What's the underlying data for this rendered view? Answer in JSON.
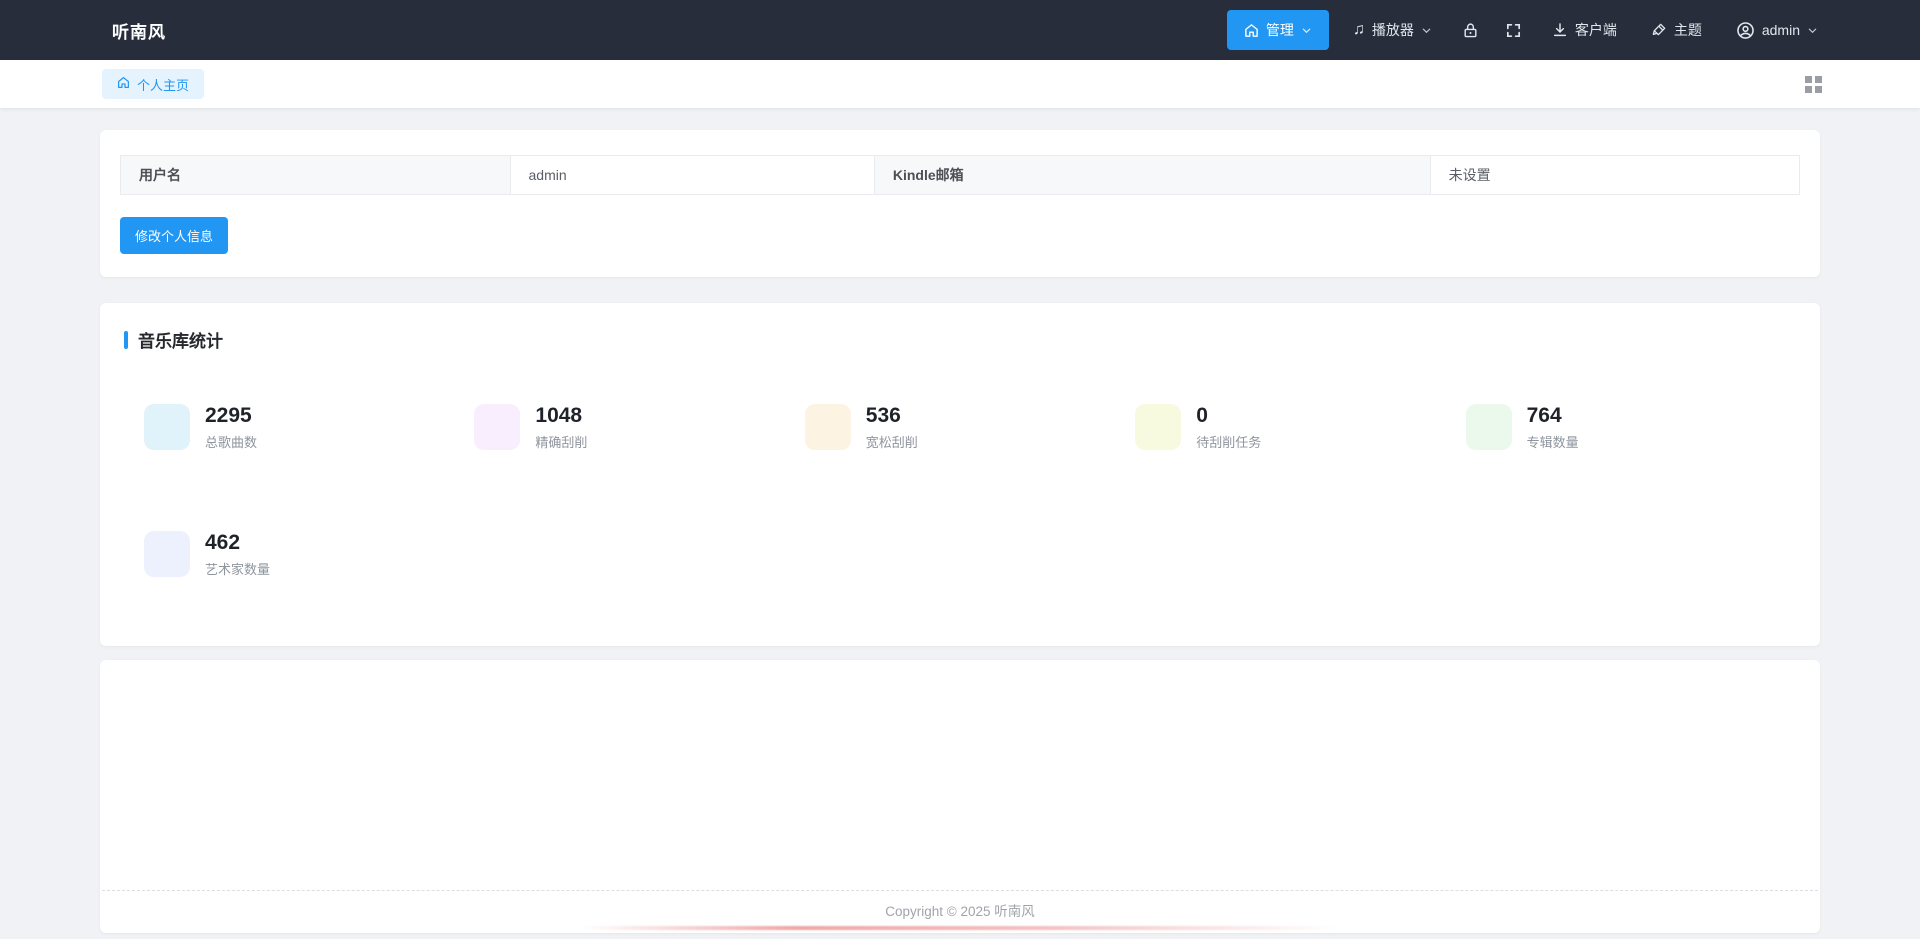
{
  "navbar": {
    "brand": "听南风",
    "manage_label": "管理",
    "player_label": "播放器",
    "client_label": "客户端",
    "theme_label": "主题",
    "username": "admin"
  },
  "tabbar": {
    "home_tab": "个人主页"
  },
  "profile": {
    "fields": [
      {
        "label": "用户名",
        "value": "admin"
      },
      {
        "label": "Kindle邮箱",
        "value": "未设置"
      }
    ],
    "edit_button": "修改个人信息"
  },
  "stats": {
    "title": "音乐库统计",
    "items": [
      {
        "value": "2295",
        "label": "总歌曲数",
        "color": "#e0f3fb"
      },
      {
        "value": "1048",
        "label": "精确刮削",
        "color": "#f8eefd"
      },
      {
        "value": "536",
        "label": "宽松刮削",
        "color": "#fdf3e3"
      },
      {
        "value": "0",
        "label": "待刮削任务",
        "color": "#f8fadf"
      },
      {
        "value": "764",
        "label": "专辑数量",
        "color": "#eaf9ec"
      },
      {
        "value": "462",
        "label": "艺术家数量",
        "color": "#edf1fd"
      }
    ]
  },
  "footer": {
    "copyright": "Copyright © 2025 听南风"
  },
  "colors": {
    "primary": "#2196f3",
    "navbar_bg": "#272d3a",
    "page_bg": "#f0f2f5"
  },
  "icons": {
    "nav": [
      "home-icon",
      "chevron-down-icon",
      "music-note-icon",
      "lock-icon",
      "fullscreen-icon",
      "download-icon",
      "brush-icon",
      "avatar-icon"
    ],
    "tab": [
      "home-icon"
    ],
    "corner": [
      "apps-grid-icon"
    ]
  }
}
